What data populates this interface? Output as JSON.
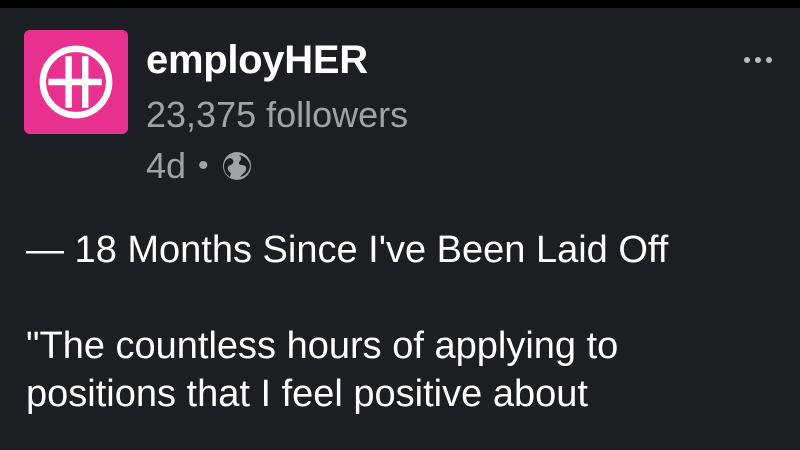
{
  "author": {
    "name": "employHER",
    "followers": "23,375 followers",
    "time": "4d",
    "separator": "•",
    "visibility_icon": "globe-icon",
    "logo_icon": "employher-logo-icon",
    "logo_color": "#e8308f"
  },
  "actions": {
    "more_icon": "more-options-icon"
  },
  "post": {
    "heading": "— 18 Months Since I've Been Laid Off",
    "quote_line_1": "\"The countless hours of applying to",
    "quote_line_2": "positions that I feel positive about"
  },
  "colors": {
    "background": "#1b1f23",
    "text_primary": "#ffffff",
    "text_secondary": "#9ea3a8"
  }
}
